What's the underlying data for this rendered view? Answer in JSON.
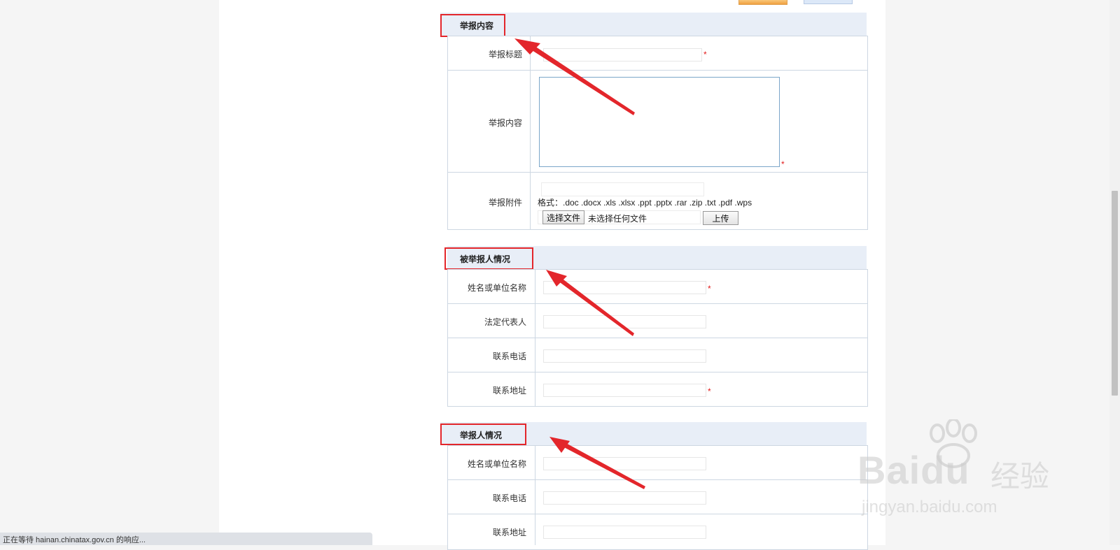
{
  "sections": {
    "report_content": {
      "title": "举报内容",
      "fields": {
        "title_label": "举报标题",
        "content_label": "举报内容",
        "attachment_label": "举报附件",
        "format_hint": "格式：.doc .docx .xls .xlsx .ppt .pptx .rar .zip .txt .pdf .wps",
        "choose_file_label": "选择文件",
        "no_file_text": "未选择任何文件",
        "upload_label": "上传"
      }
    },
    "reported_party": {
      "title": "被举报人情况",
      "fields": {
        "name_label": "姓名或单位名称",
        "legal_rep_label": "法定代表人",
        "phone_label": "联系电话",
        "address_label": "联系地址"
      }
    },
    "reporter": {
      "title": "举报人情况",
      "fields": {
        "name_label": "姓名或单位名称",
        "phone_label": "联系电话",
        "address_label": "联系地址"
      }
    }
  },
  "required_mark": "*",
  "status_bar": {
    "text": "正在等待 hainan.chinatax.gov.cn 的响应..."
  },
  "watermark": {
    "brand": "Bai",
    "brand_suffix": "du",
    "brand_cn": "经验",
    "url": "jingyan.baidu.com"
  },
  "annotation_color": "#e3262b"
}
